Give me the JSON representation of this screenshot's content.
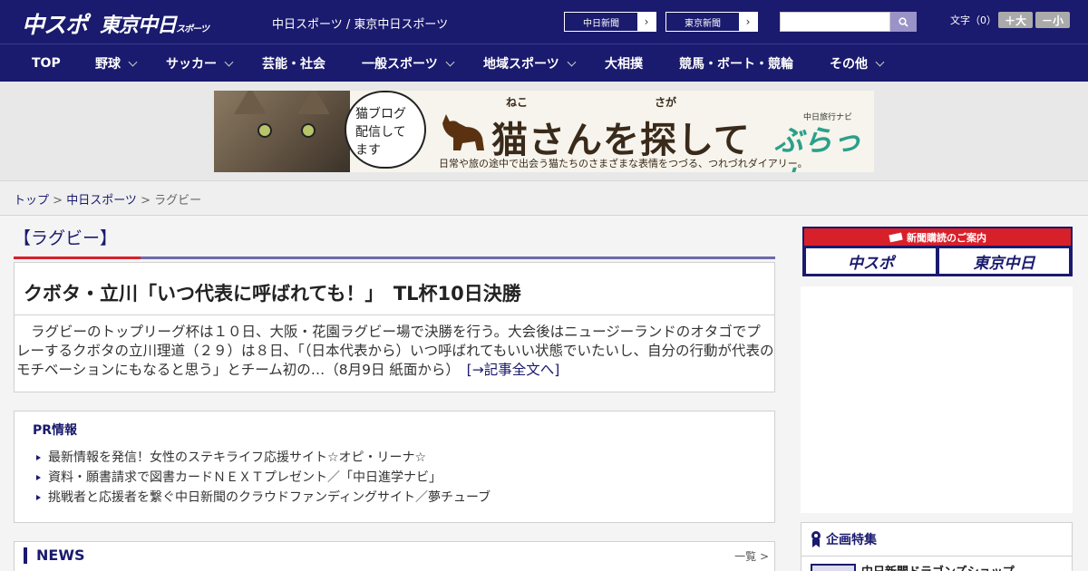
{
  "header": {
    "logo_chuspo": "中スポ",
    "logo_tokyo": "東京中日",
    "logo_tokyo_small": "スポーツ",
    "site_title": "中日スポーツ / 東京中日スポーツ",
    "paper_links": [
      {
        "label": "中日新聞"
      },
      {
        "label": "東京新聞"
      }
    ],
    "search_placeholder": "",
    "fontsize_label": "文字（0）",
    "font_larger": "＋大",
    "font_smaller": "－小"
  },
  "nav": [
    {
      "label": "TOP",
      "dropdown": false
    },
    {
      "label": "野球",
      "dropdown": true
    },
    {
      "label": "サッカー",
      "dropdown": true
    },
    {
      "label": "芸能・社会",
      "dropdown": false
    },
    {
      "label": "一般スポーツ",
      "dropdown": true
    },
    {
      "label": "地域スポーツ",
      "dropdown": true
    },
    {
      "label": "大相撲",
      "dropdown": false
    },
    {
      "label": "競馬・ボート・競輪",
      "dropdown": false
    },
    {
      "label": "その他",
      "dropdown": true
    }
  ],
  "banner": {
    "bubble_text": "猫ブログ 配信して ます",
    "title": "猫さんを探して",
    "ruby_neko": "ねこ",
    "ruby_sagashi": "さが",
    "subtitle": "日常や旅の途中で出会う猫たちのさまざまな表情をつづる、つれづれダイアリー。",
    "brand_small": "中日旅行ナビ",
    "brand": "ぶらっ人"
  },
  "breadcrumb": {
    "top": "トップ",
    "section": "中日スポーツ",
    "current": "ラグビー"
  },
  "category_heading": "【ラグビー】",
  "article": {
    "title": "クボタ・立川「いつ代表に呼ばれても！」　TL杯10日決勝",
    "body": "ラグビーのトップリーグ杯は１０日、大阪・花園ラグビー場で決勝を行う。大会後はニュージーランドのオタゴでプレーするクボタの立川理道（２９）は８日、「（日本代表から）いつ呼ばれてもいい状態でいたいし、自分の行動が代表のモチベーションにもなると思う」とチーム初の…（8月9日 紙面から）",
    "read_more": "[→記事全文へ]"
  },
  "pr": {
    "title": "PR情報",
    "items": [
      "最新情報を発信！女性のステキライフ応援サイト☆オピ・リーナ☆",
      "資料・願書請求で図書カードＮＥＸＴプレゼント／「中日進学ナビ」",
      "挑戦者と応援者を繋ぐ中日新聞のクラウドファンディングサイト／夢チューブ"
    ]
  },
  "news": {
    "title": "NEWS",
    "more": "一覧 >"
  },
  "sidebar": {
    "subscription_head": "新聞購読のご案内",
    "sub_logo_1": "中スポ",
    "sub_logo_2": "東京中日",
    "feature_title": "企画特集",
    "feature_item": "中日新聞ドラゴンズショップ"
  },
  "colors": {
    "navy": "#1a1a6e",
    "red": "#d8202a",
    "purple_line": "#6d6aaa"
  }
}
